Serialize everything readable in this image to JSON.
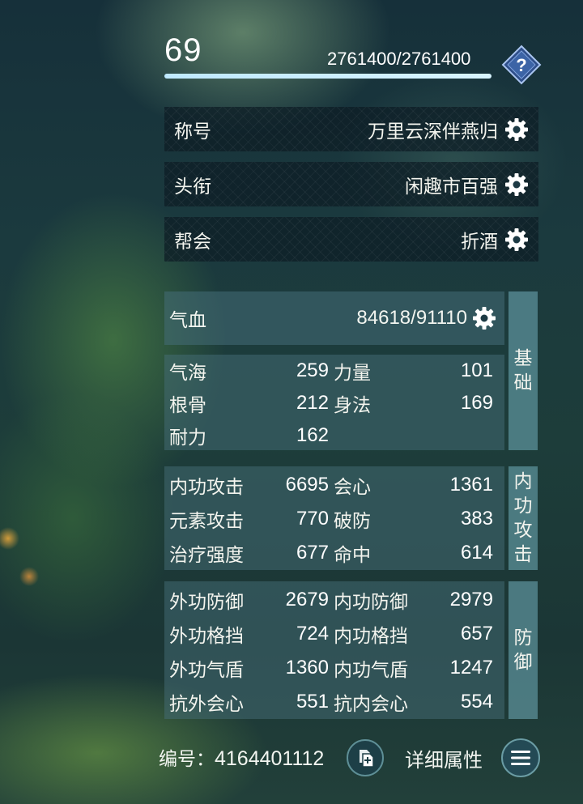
{
  "header": {
    "level": "69",
    "exp_text": "2761400/2761400",
    "exp_progress": 1.0
  },
  "info_rows": [
    {
      "label": "称号",
      "value": "万里云深伴燕归"
    },
    {
      "label": "头衔",
      "value": "闲趣市百强"
    },
    {
      "label": "帮会",
      "value": "折酒"
    }
  ],
  "hp": {
    "label": "气血",
    "value": "84618/91110"
  },
  "sections": {
    "basic": {
      "tab": "基础",
      "rows": [
        [
          {
            "name": "气海",
            "value": "259"
          },
          {
            "name": "力量",
            "value": "101"
          }
        ],
        [
          {
            "name": "根骨",
            "value": "212"
          },
          {
            "name": "身法",
            "value": "169"
          }
        ],
        [
          {
            "name": "耐力",
            "value": "162"
          },
          {
            "name": "",
            "value": ""
          }
        ]
      ]
    },
    "attack": {
      "tab": "内功攻击",
      "rows": [
        [
          {
            "name": "内功攻击",
            "value": "6695"
          },
          {
            "name": "会心",
            "value": "1361"
          }
        ],
        [
          {
            "name": "元素攻击",
            "value": "770"
          },
          {
            "name": "破防",
            "value": "383"
          }
        ],
        [
          {
            "name": "治疗强度",
            "value": "677"
          },
          {
            "name": "命中",
            "value": "614"
          }
        ]
      ]
    },
    "defense": {
      "tab": "防御",
      "rows": [
        [
          {
            "name": "外功防御",
            "value": "2679"
          },
          {
            "name": "内功防御",
            "value": "2979"
          }
        ],
        [
          {
            "name": "外功格挡",
            "value": "724"
          },
          {
            "name": "内功格挡",
            "value": "657"
          }
        ],
        [
          {
            "name": "外功气盾",
            "value": "1360"
          },
          {
            "name": "内功气盾",
            "value": "1247"
          }
        ],
        [
          {
            "name": "抗外会心",
            "value": "551"
          },
          {
            "name": "抗内会心",
            "value": "554"
          }
        ]
      ]
    }
  },
  "footer": {
    "id_label": "编号：",
    "id_value": "4164401112",
    "detail_label": "详细属性"
  },
  "icons": {
    "help": "help-diamond-icon",
    "gear": "gear-icon",
    "copy": "copy-icon",
    "menu": "hamburger-menu-icon"
  }
}
